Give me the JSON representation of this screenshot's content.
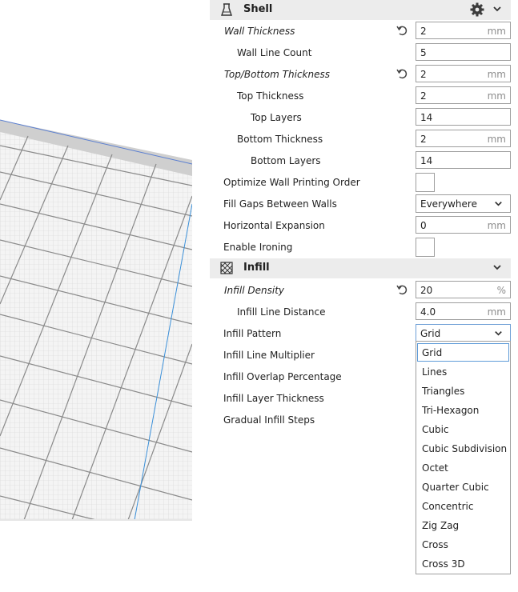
{
  "shell": {
    "title": "Shell",
    "icon": "shell-icon",
    "rows": [
      {
        "label": "Wall Thickness",
        "value": "2",
        "unit": "mm"
      },
      {
        "label": "Wall Line Count",
        "value": "5"
      },
      {
        "label": "Top/Bottom Thickness",
        "value": "2",
        "unit": "mm"
      },
      {
        "label": "Top Thickness",
        "value": "2",
        "unit": "mm"
      },
      {
        "label": "Top Layers",
        "value": "14"
      },
      {
        "label": "Bottom Thickness",
        "value": "2",
        "unit": "mm"
      },
      {
        "label": "Bottom Layers",
        "value": "14"
      },
      {
        "label": "Optimize Wall Printing Order",
        "checked": false
      },
      {
        "label": "Fill Gaps Between Walls",
        "value": "Everywhere"
      },
      {
        "label": "Horizontal Expansion",
        "value": "0",
        "unit": "mm"
      },
      {
        "label": "Enable Ironing",
        "checked": false
      }
    ]
  },
  "infill": {
    "title": "Infill",
    "icon": "infill-icon",
    "rows": [
      {
        "label": "Infill Density",
        "value": "20",
        "unit": "%"
      },
      {
        "label": "Infill Line Distance",
        "value": "4.0",
        "unit": "mm"
      },
      {
        "label": "Infill Pattern",
        "value": "Grid"
      },
      {
        "label": "Infill Line Multiplier"
      },
      {
        "label": "Infill Overlap Percentage"
      },
      {
        "label": "Infill Layer Thickness"
      },
      {
        "label": "Gradual Infill Steps"
      }
    ]
  },
  "infill_pattern_options": [
    "Grid",
    "Lines",
    "Triangles",
    "Tri-Hexagon",
    "Cubic",
    "Cubic Subdivision",
    "Octet",
    "Quarter Cubic",
    "Concentric",
    "Zig Zag",
    "Cross",
    "Cross 3D"
  ],
  "colors": {
    "header_bg": "#ececec",
    "field_border": "#9e9e9e",
    "selection_border": "#5f9bd8",
    "build_plate": "#dcdcdc",
    "viewport_line": "#3a8fd8"
  }
}
